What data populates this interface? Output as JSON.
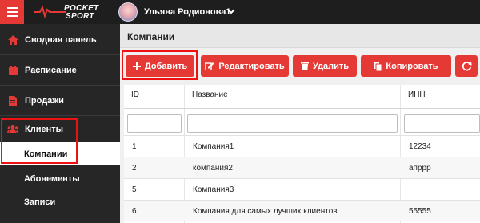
{
  "app": {
    "logo_top": "POCKET",
    "logo_bottom": "SPORT",
    "username": "Ульяна Родионова1",
    "accent_color": "#e53935"
  },
  "sidebar": {
    "items": [
      {
        "label": "Сводная панель",
        "icon": "home-icon"
      },
      {
        "label": "Расписание",
        "icon": "calendar-icon"
      },
      {
        "label": "Продажи",
        "icon": "document-icon"
      },
      {
        "label": "Клиенты",
        "icon": "users-icon"
      }
    ],
    "subitems": [
      {
        "label": "Компании",
        "active": true
      },
      {
        "label": "Абонементы",
        "active": false
      },
      {
        "label": "Записи",
        "active": false
      }
    ]
  },
  "page": {
    "title": "Компании"
  },
  "toolbar": {
    "add_label": "Добавить",
    "edit_label": "Редактировать",
    "delete_label": "Удалить",
    "copy_label": "Копировать"
  },
  "table": {
    "columns": [
      "ID",
      "Название",
      "ИНН"
    ],
    "rows": [
      {
        "id": "1",
        "name": "Компания1",
        "inn": "12234"
      },
      {
        "id": "2",
        "name": "компания2",
        "inn": "апррр"
      },
      {
        "id": "5",
        "name": "Компания3",
        "inn": ""
      },
      {
        "id": "6",
        "name": "Компания для самых лучших клиентов",
        "inn": "55555"
      }
    ]
  }
}
